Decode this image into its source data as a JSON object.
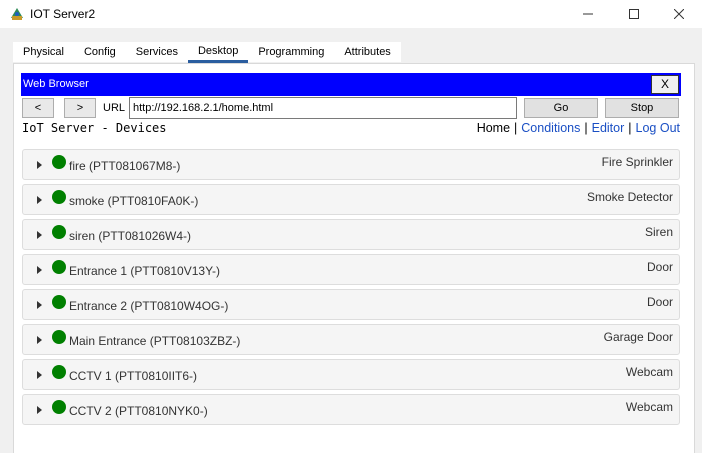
{
  "window": {
    "title": "IOT Server2",
    "colors": {
      "titlebar": "#ffffff",
      "body": "#f0f0f0"
    }
  },
  "tabs": [
    {
      "label": "Physical",
      "active": false
    },
    {
      "label": "Config",
      "active": false
    },
    {
      "label": "Services",
      "active": false
    },
    {
      "label": "Desktop",
      "active": true
    },
    {
      "label": "Programming",
      "active": false
    },
    {
      "label": "Attributes",
      "active": false
    }
  ],
  "browser": {
    "title": "Web Browser",
    "close_label": "X",
    "back_label": "<",
    "forward_label": ">",
    "url_label": "URL",
    "url_value": "http://192.168.2.1/home.html",
    "go_label": "Go",
    "stop_label": "Stop",
    "title_bar_color": "#0000ff"
  },
  "page": {
    "title": "IoT Server - Devices",
    "nav": {
      "home": "Home",
      "conditions": "Conditions",
      "editor": "Editor",
      "logout": "Log Out"
    },
    "link_color": "#1a4fc4"
  },
  "devices": [
    {
      "name": "fire (PTT081067M8-)",
      "type": "Fire Sprinkler",
      "status_color": "#008000"
    },
    {
      "name": "smoke (PTT0810FA0K-)",
      "type": "Smoke Detector",
      "status_color": "#008000"
    },
    {
      "name": "siren (PTT081026W4-)",
      "type": "Siren",
      "status_color": "#008000"
    },
    {
      "name": "Entrance 1 (PTT0810V13Y-)",
      "type": "Door",
      "status_color": "#008000"
    },
    {
      "name": "Entrance 2 (PTT0810W4OG-)",
      "type": "Door",
      "status_color": "#008000"
    },
    {
      "name": "Main Entrance (PTT08103ZBZ-)",
      "type": "Garage Door",
      "status_color": "#008000"
    },
    {
      "name": "CCTV 1 (PTT0810IIT6-)",
      "type": "Webcam",
      "status_color": "#008000"
    },
    {
      "name": "CCTV 2 (PTT0810NYK0-)",
      "type": "Webcam",
      "status_color": "#008000"
    }
  ]
}
